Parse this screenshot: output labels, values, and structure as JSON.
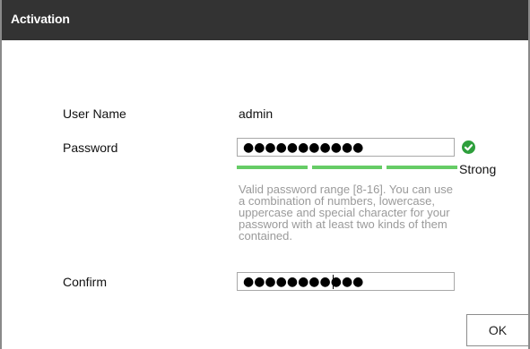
{
  "window": {
    "title": "Activation"
  },
  "form": {
    "username_label": "User Name",
    "username_value": "admin",
    "password_label": "Password",
    "password_value": "●●●●●●●●●●●",
    "confirm_label": "Confirm",
    "confirm_value": "●●●●●●●●●●●",
    "strength_text": "Strong",
    "password_hint": "Valid password range [8-16]. You can use a combination of numbers, lowercase, uppercase and special character for your password with at least two kinds of them contained."
  },
  "strength_meter": {
    "segments": 3,
    "filled_segments": 3,
    "color": "#66cc66"
  },
  "status": {
    "valid_icon": "check-circle-icon",
    "valid_color": "#2e9f3c"
  },
  "actions": {
    "ok_label": "OK"
  }
}
